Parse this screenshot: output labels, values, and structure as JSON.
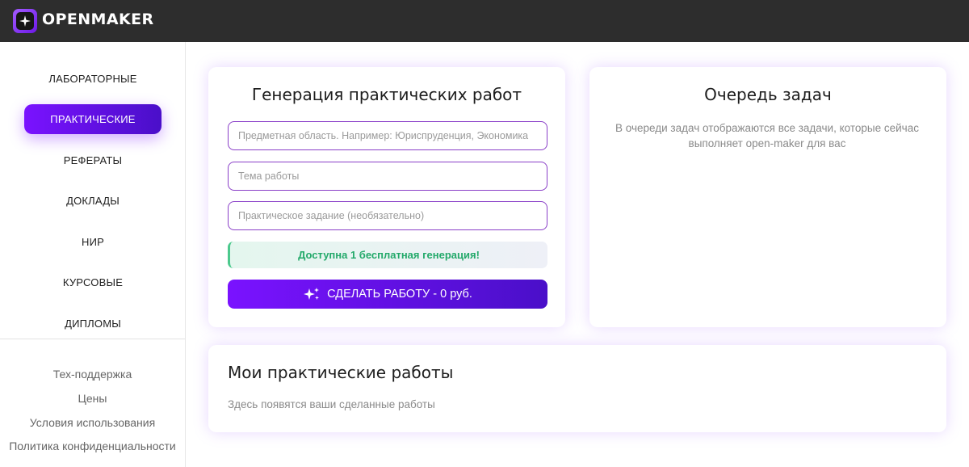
{
  "header": {
    "brand": "OPENMAKER"
  },
  "sidebar": {
    "items": [
      {
        "label": "ЛАБОРАТОРНЫЕ",
        "active": false
      },
      {
        "label": "ПРАКТИЧЕСКИЕ",
        "active": true
      },
      {
        "label": "РЕФЕРАТЫ",
        "active": false
      },
      {
        "label": "ДОКЛАДЫ",
        "active": false
      },
      {
        "label": "НИР",
        "active": false
      },
      {
        "label": "КУРСОВЫЕ",
        "active": false
      },
      {
        "label": "ДИПЛОМЫ",
        "active": false
      }
    ],
    "footer_links": [
      "Тех-поддержка",
      "Цены",
      "Условия использования",
      "Политика конфиденциальности"
    ]
  },
  "generator": {
    "title": "Генерация практических работ",
    "subject_placeholder": "Предметная область. Например: Юриспруденция, Экономика",
    "topic_placeholder": "Тема работы",
    "task_placeholder": "Практическое задание (необязательно)",
    "notice": "Доступна 1 бесплатная генерация!",
    "submit_label": "СДЕЛАТЬ РАБОТУ - 0 руб."
  },
  "queue": {
    "title": "Очередь задач",
    "description": "В очереди задач отображаются все задачи, которые сейчас выполняет open-maker для вас"
  },
  "works": {
    "title": "Мои практические работы",
    "empty_text": "Здесь появятся ваши сделанные работы"
  },
  "colors": {
    "accent": "#7a12ff",
    "accent_dark": "#4a0fc9",
    "success": "#23a96a",
    "topbar": "#2d2d2d"
  },
  "icons": {
    "logo": "sparkle-star-icon",
    "submit": "sparkles-icon"
  }
}
